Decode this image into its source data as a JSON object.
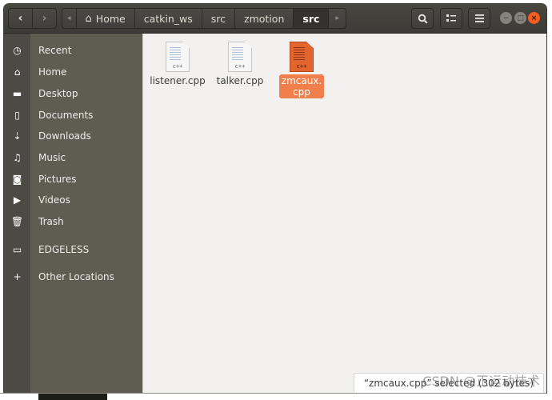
{
  "headerbar": {
    "nav_back_icon": "‹",
    "nav_forward_icon": "›",
    "path_scroll_left_icon": "◂",
    "path_scroll_right_icon": "▸",
    "breadcrumbs": [
      {
        "label": "Home",
        "icon": "home-icon"
      },
      {
        "label": "catkin_ws"
      },
      {
        "label": "src"
      },
      {
        "label": "zmotion"
      },
      {
        "label": "src",
        "active": true
      }
    ],
    "search_icon": "🔍",
    "view_toggle_icon": "☷",
    "menu_icon": "≡",
    "window_controls": {
      "minimize": "−",
      "maximize": "□",
      "close": "×"
    }
  },
  "sidebar": {
    "items": [
      {
        "label": "Recent",
        "icon": "◷"
      },
      {
        "label": "Home",
        "icon": "⌂"
      },
      {
        "label": "Desktop",
        "icon": "▬"
      },
      {
        "label": "Documents",
        "icon": "▯"
      },
      {
        "label": "Downloads",
        "icon": "⇣"
      },
      {
        "label": "Music",
        "icon": "♫"
      },
      {
        "label": "Pictures",
        "icon": "◙"
      },
      {
        "label": "Videos",
        "icon": "▶"
      },
      {
        "label": "Trash",
        "icon": "🗑"
      },
      {
        "label": "EDGELESS",
        "icon": "▭",
        "eject_icon": "⏏"
      },
      {
        "label": "Other Locations",
        "icon": "+"
      }
    ]
  },
  "files": [
    {
      "name": "listener.cpp",
      "type_label": "c++",
      "selected": false
    },
    {
      "name": "talker.cpp",
      "type_label": "c++",
      "selected": false
    },
    {
      "name_line1": "zmcaux.",
      "name_line2": "cpp",
      "type_label": "c++",
      "selected": true
    }
  ],
  "status": {
    "text": "“zmcaux.cpp” selected (302 bytes)"
  },
  "watermark": "CSDN @正运动技术",
  "colors": {
    "accent": "#f07f4c",
    "close_button": "#f15d22",
    "sidebar_bg": "#5f5c51",
    "headerbar_bg": "#3c3b37"
  }
}
